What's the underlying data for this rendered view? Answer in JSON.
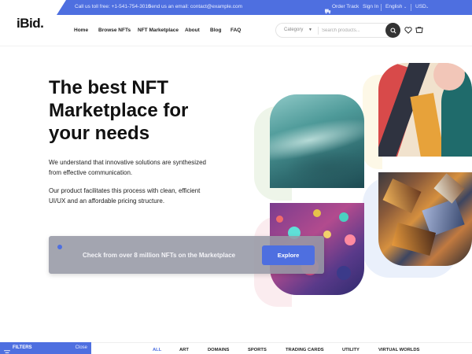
{
  "topbar": {
    "phone": "Call us toll free: +1-541-754-3010",
    "email": "Send us an email: contact@example.com",
    "order_track": "Order Track",
    "sign_in": "Sign In",
    "language": "English",
    "currency": "USD"
  },
  "header": {
    "logo": "iBid.",
    "nav": [
      "Home",
      "Browse NFTs",
      "NFT Marketplace",
      "About",
      "Blog",
      "FAQ"
    ],
    "search": {
      "category": "Category",
      "placeholder": "Search products..."
    }
  },
  "hero": {
    "title_lines": [
      "The best NFT",
      "Marketplace for",
      "your needs"
    ],
    "paragraph1_lines": [
      "We understand that innovative solutions are synthesized",
      "from effective communication."
    ],
    "paragraph2_lines": [
      "Our product facilitates this process with clean, efficient",
      "UI/UX and an affordable pricing structure."
    ]
  },
  "cta": {
    "text": "Check from over 8 million NFTs on the Marketplace",
    "button": "Explore"
  },
  "filters": {
    "label": "FILTERS",
    "close": "Close",
    "categories": [
      "ALL",
      "ART",
      "DOMAINS",
      "SPORTS",
      "TRADING CARDS",
      "UTILITY",
      "VIRTUAL WORLDS"
    ],
    "active_category": "ALL"
  },
  "colors": {
    "accent": "#4e6fe0",
    "cta_panel": "#9698a5"
  }
}
